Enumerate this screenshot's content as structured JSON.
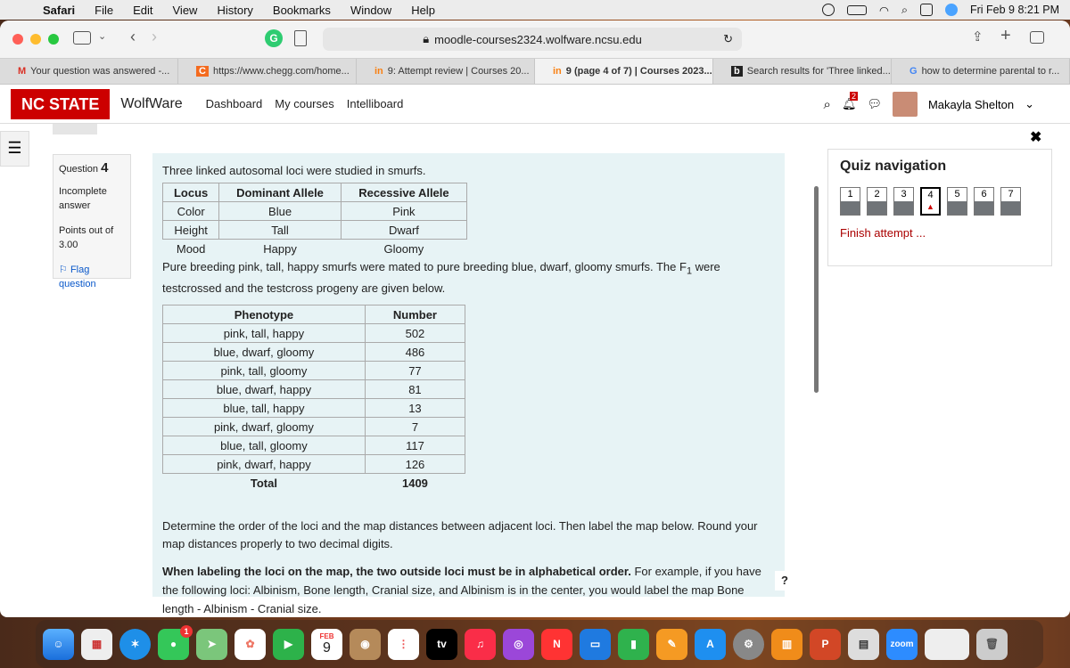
{
  "menubar": {
    "app": "Safari",
    "items": [
      "File",
      "Edit",
      "View",
      "History",
      "Bookmarks",
      "Window",
      "Help"
    ],
    "datetime": "Fri Feb 9  8:21 PM"
  },
  "browser": {
    "url": "moodle-courses2324.wolfware.ncsu.edu"
  },
  "tabs": [
    {
      "favicon": "M",
      "label": "Your question was answered -..."
    },
    {
      "favicon": "C",
      "label": "https://www.chegg.com/home..."
    },
    {
      "favicon": "in",
      "label": "9: Attempt review | Courses 20..."
    },
    {
      "favicon": "in",
      "label": "9 (page 4 of 7) | Courses 2023..."
    },
    {
      "favicon": "b",
      "label": "Search results for 'Three linked..."
    },
    {
      "favicon": "G",
      "label": "how to determine parental to r..."
    }
  ],
  "site": {
    "brand": "NC STATE",
    "name": "WolfWare",
    "links": [
      "Dashboard",
      "My courses",
      "Intelliboard"
    ],
    "notif_count": "2",
    "user": "Makayla Shelton"
  },
  "question_info": {
    "label": "Question",
    "number": "4",
    "state": "Incomplete answer",
    "points_label": "Points out of",
    "points": "3.00",
    "flag": "Flag question"
  },
  "question": {
    "intro": "Three linked autosomal loci were studied in smurfs.",
    "loci_headers": [
      "Locus",
      "Dominant Allele",
      "Recessive Allele"
    ],
    "loci_rows": [
      [
        "Color",
        "Blue",
        "Pink"
      ],
      [
        "Height",
        "Tall",
        "Dwarf"
      ],
      [
        "Mood",
        "Happy",
        "Gloomy"
      ]
    ],
    "cross_a": "Pure breeding pink, tall, happy smurfs were mated to pure breeding blue, dwarf, gloomy smurfs. The F",
    "cross_sub": "1",
    "cross_b": " were testcrossed and the testcross progeny are given below.",
    "pheno_headers": [
      "Phenotype",
      "Number"
    ],
    "pheno_rows": [
      [
        "pink, tall, happy",
        "502"
      ],
      [
        "blue, dwarf, gloomy",
        "486"
      ],
      [
        "pink, tall, gloomy",
        "77"
      ],
      [
        "blue, dwarf, happy",
        "81"
      ],
      [
        "blue, tall, happy",
        "13"
      ],
      [
        "pink, dwarf, gloomy",
        "7"
      ],
      [
        "blue, tall, gloomy",
        "117"
      ],
      [
        "pink, dwarf, happy",
        "126"
      ]
    ],
    "total_label": "Total",
    "total": "1409",
    "instruction": "Determine the order of the loci and the map distances between adjacent loci. Then label the map below. Round your map distances properly to two decimal digits.",
    "bold_rule": "When labeling the loci on the map, the two outside loci must be in alphabetical order.",
    "example": " For example, if you have the following loci: Albinism, Bone length, Cranial size, and Albinism is in the center, you would label the map Bone length - Albinism - Cranial size."
  },
  "quiz_nav": {
    "title": "Quiz navigation",
    "questions": [
      "1",
      "2",
      "3",
      "4",
      "5",
      "6",
      "7"
    ],
    "current": "4",
    "finish": "Finish attempt ..."
  },
  "dock": {
    "calendar_month": "FEB",
    "calendar_day": "9",
    "tv": "tv",
    "zoom": "zoom",
    "badge": "1"
  }
}
